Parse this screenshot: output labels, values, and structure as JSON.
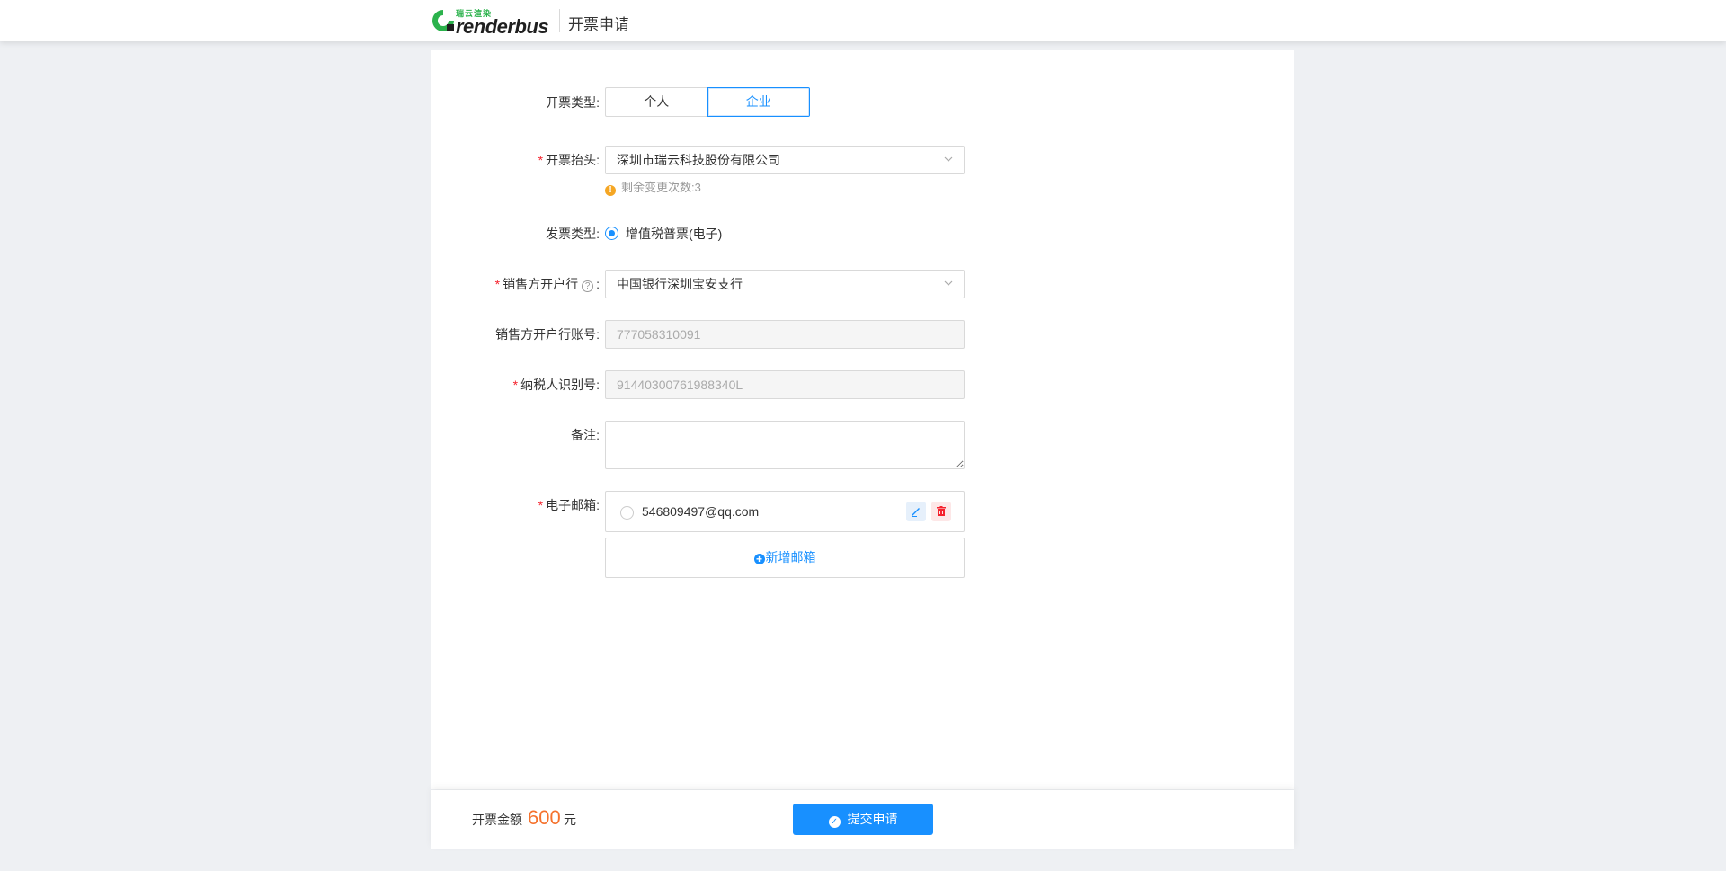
{
  "header": {
    "logo_sub": "瑞云渲染",
    "logo_text": "renderbus",
    "title": "开票申请"
  },
  "form": {
    "invoice_category": {
      "label": "开票类型:",
      "options": [
        "个人",
        "企业"
      ],
      "selected": "企业"
    },
    "invoice_title": {
      "label": "开票抬头:",
      "required": "*",
      "value": "深圳市瑞云科技股份有限公司",
      "tip": "剩余变更次数:3",
      "tip_icon": "!"
    },
    "invoice_type": {
      "label": "发票类型:",
      "option": "增值税普票(电子)"
    },
    "seller_bank": {
      "label": "销售方开户行",
      "suffix": ":",
      "required": "*",
      "help_icon": "?",
      "value": "中国银行深圳宝安支行"
    },
    "seller_account": {
      "label": "销售方开户行账号:",
      "placeholder": "777058310091"
    },
    "taxpayer_id": {
      "label": "纳税人识别号:",
      "required": "*",
      "placeholder": "91440300761988340L"
    },
    "remark": {
      "label": "备注:",
      "value": ""
    },
    "email": {
      "label": "电子邮箱:",
      "required": "*",
      "value": "546809497@qq.com",
      "add_label": "新增邮箱"
    }
  },
  "footer": {
    "amount_label": "开票金额",
    "amount_value": "600",
    "amount_unit": "元",
    "submit_label": "提交申请"
  },
  "colors": {
    "primary": "#1890ff",
    "required": "#f5222d",
    "amount": "#f5722d",
    "warning": "#f5a623",
    "brand_green": "#2bb24c"
  }
}
